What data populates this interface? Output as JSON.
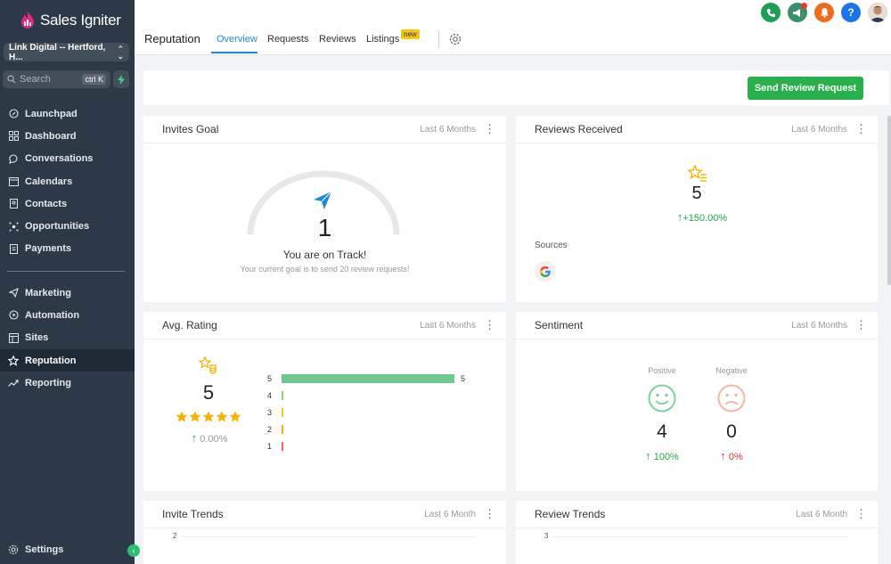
{
  "app": {
    "brand": "Sales Igniter",
    "location": "Link Digital -- Hertford, H...",
    "search_placeholder": "Search",
    "search_shortcut": "ctrl K"
  },
  "sidebar": {
    "items_top": [
      {
        "label": "Launchpad",
        "icon": "rocket-icon"
      },
      {
        "label": "Dashboard",
        "icon": "grid-icon"
      },
      {
        "label": "Conversations",
        "icon": "chat-icon"
      },
      {
        "label": "Calendars",
        "icon": "calendar-icon"
      },
      {
        "label": "Contacts",
        "icon": "contacts-icon"
      },
      {
        "label": "Opportunities",
        "icon": "opportunities-icon"
      },
      {
        "label": "Payments",
        "icon": "payments-icon"
      }
    ],
    "items_bottom": [
      {
        "label": "Marketing",
        "icon": "send-icon"
      },
      {
        "label": "Automation",
        "icon": "automation-icon"
      },
      {
        "label": "Sites",
        "icon": "sites-icon"
      },
      {
        "label": "Reputation",
        "icon": "star-icon"
      },
      {
        "label": "Reporting",
        "icon": "trend-icon"
      }
    ],
    "settings": "Settings"
  },
  "topbar": {
    "title": "Reputation",
    "tabs": [
      "Overview",
      "Requests",
      "Reviews",
      "Listings"
    ],
    "new_badge": "new"
  },
  "actions": {
    "send_review_request": "Send Review Request"
  },
  "invites_goal": {
    "title": "Invites Goal",
    "range": "Last 6 Months",
    "count": "1",
    "status": "You are on Track!",
    "note": "Your current goal is to send 20 review requests!",
    "progress": 0.05
  },
  "reviews_received": {
    "title": "Reviews Received",
    "range": "Last 6 Months",
    "count": "5",
    "change": "+150.00%",
    "sources_label": "Sources"
  },
  "avg_rating": {
    "title": "Avg. Rating",
    "range": "Last 6 Months",
    "value": "5",
    "stars": 5,
    "change": "0.00%",
    "distribution": [
      {
        "star": "5",
        "count": 5,
        "value_label": "5"
      },
      {
        "star": "4",
        "count": 0,
        "value_label": ""
      },
      {
        "star": "3",
        "count": 0,
        "value_label": ""
      },
      {
        "star": "2",
        "count": 0,
        "value_label": ""
      },
      {
        "star": "1",
        "count": 0,
        "value_label": ""
      }
    ]
  },
  "sentiment": {
    "title": "Sentiment",
    "range": "Last 6 Months",
    "positive_label": "Positive",
    "positive_count": "4",
    "positive_change": "100%",
    "negative_label": "Negative",
    "negative_count": "0",
    "negative_change": "0%"
  },
  "invite_trends": {
    "title": "Invite Trends",
    "range": "Last 6 Month",
    "y_top": "2"
  },
  "review_trends": {
    "title": "Review Trends",
    "range": "Last 6 Month",
    "y_top": "3"
  },
  "colors": {
    "sidebar_bg": "#2c3a48",
    "accent_blue": "#1a8bd6",
    "success_green": "#28b04d",
    "bar_green": "#6fc791",
    "star_yellow": "#f5b400"
  }
}
